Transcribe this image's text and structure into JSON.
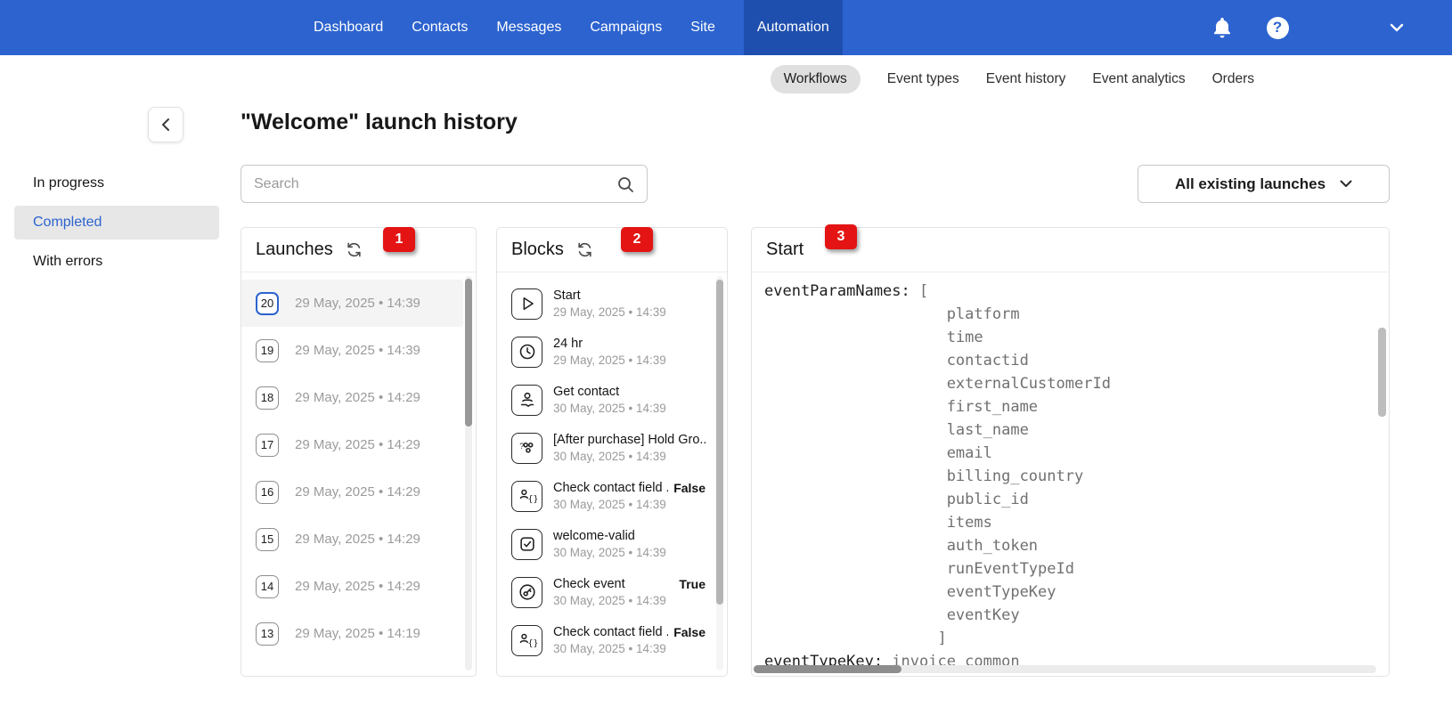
{
  "topnav": {
    "items": [
      {
        "label": "Dashboard",
        "active": false
      },
      {
        "label": "Contacts",
        "active": false
      },
      {
        "label": "Messages",
        "active": false
      },
      {
        "label": "Campaigns",
        "active": false
      },
      {
        "label": "Site",
        "active": false
      },
      {
        "label": "Automation",
        "active": true
      }
    ]
  },
  "subnav": {
    "items": [
      {
        "label": "Workflows",
        "active": true
      },
      {
        "label": "Event types",
        "active": false
      },
      {
        "label": "Event history",
        "active": false
      },
      {
        "label": "Event analytics",
        "active": false
      },
      {
        "label": "Orders",
        "active": false
      }
    ]
  },
  "page": {
    "title": "\"Welcome\" launch history",
    "search_placeholder": "Search",
    "filter_label": "All existing launches"
  },
  "status_filters": {
    "items": [
      {
        "label": "In progress",
        "active": false
      },
      {
        "label": "Completed",
        "active": true
      },
      {
        "label": "With errors",
        "active": false
      }
    ]
  },
  "launches": {
    "title": "Launches",
    "badge": "1",
    "items": [
      {
        "number": "20",
        "date": "29 May, 2025 • 14:39",
        "selected": true
      },
      {
        "number": "19",
        "date": "29 May, 2025 • 14:39",
        "selected": false
      },
      {
        "number": "18",
        "date": "29 May, 2025 • 14:29",
        "selected": false
      },
      {
        "number": "17",
        "date": "29 May, 2025 • 14:29",
        "selected": false
      },
      {
        "number": "16",
        "date": "29 May, 2025 • 14:29",
        "selected": false
      },
      {
        "number": "15",
        "date": "29 May, 2025 • 14:29",
        "selected": false
      },
      {
        "number": "14",
        "date": "29 May, 2025 • 14:29",
        "selected": false
      },
      {
        "number": "13",
        "date": "29 May, 2025 • 14:19",
        "selected": false
      }
    ]
  },
  "blocks": {
    "title": "Blocks",
    "badge": "2",
    "items": [
      {
        "icon": "play-icon",
        "title": "Start",
        "date": "29 May, 2025 • 14:39",
        "flag": ""
      },
      {
        "icon": "clock-icon",
        "title": "24 hr",
        "date": "29 May, 2025 • 14:39",
        "flag": ""
      },
      {
        "icon": "get-contact-icon",
        "title": "Get contact",
        "date": "30 May, 2025 • 14:39",
        "flag": ""
      },
      {
        "icon": "hold-group-icon",
        "title": "[After purchase] Hold Gro...",
        "date": "30 May, 2025 • 14:39",
        "flag": ""
      },
      {
        "icon": "contact-field-icon",
        "title": "Check contact field ...",
        "date": "30 May, 2025 • 14:39",
        "flag": "False"
      },
      {
        "icon": "checkbox-icon",
        "title": "welcome-valid",
        "date": "30 May, 2025 • 14:39",
        "flag": ""
      },
      {
        "icon": "key-icon",
        "title": "Check event",
        "date": "30 May, 2025 • 14:39",
        "flag": "True"
      },
      {
        "icon": "contact-field-icon",
        "title": "Check contact field ...",
        "date": "30 May, 2025 • 14:39",
        "flag": "False"
      }
    ]
  },
  "detail": {
    "title": "Start",
    "badge": "3",
    "code_lines": [
      {
        "key": "eventParamNames:",
        "value": " ["
      },
      {
        "key": "",
        "value": "                    platform"
      },
      {
        "key": "",
        "value": "                    time"
      },
      {
        "key": "",
        "value": "                    contactid"
      },
      {
        "key": "",
        "value": "                    externalCustomerId"
      },
      {
        "key": "",
        "value": "                    first_name"
      },
      {
        "key": "",
        "value": "                    last_name"
      },
      {
        "key": "",
        "value": "                    email"
      },
      {
        "key": "",
        "value": "                    billing_country"
      },
      {
        "key": "",
        "value": "                    public_id"
      },
      {
        "key": "",
        "value": "                    items"
      },
      {
        "key": "",
        "value": "                    auth_token"
      },
      {
        "key": "",
        "value": "                    runEventTypeId"
      },
      {
        "key": "",
        "value": "                    eventTypeKey"
      },
      {
        "key": "",
        "value": "                    eventKey"
      },
      {
        "key": "",
        "value": "                   ]"
      },
      {
        "key": "eventTypeKey:",
        "value": " invoice_common"
      }
    ]
  }
}
